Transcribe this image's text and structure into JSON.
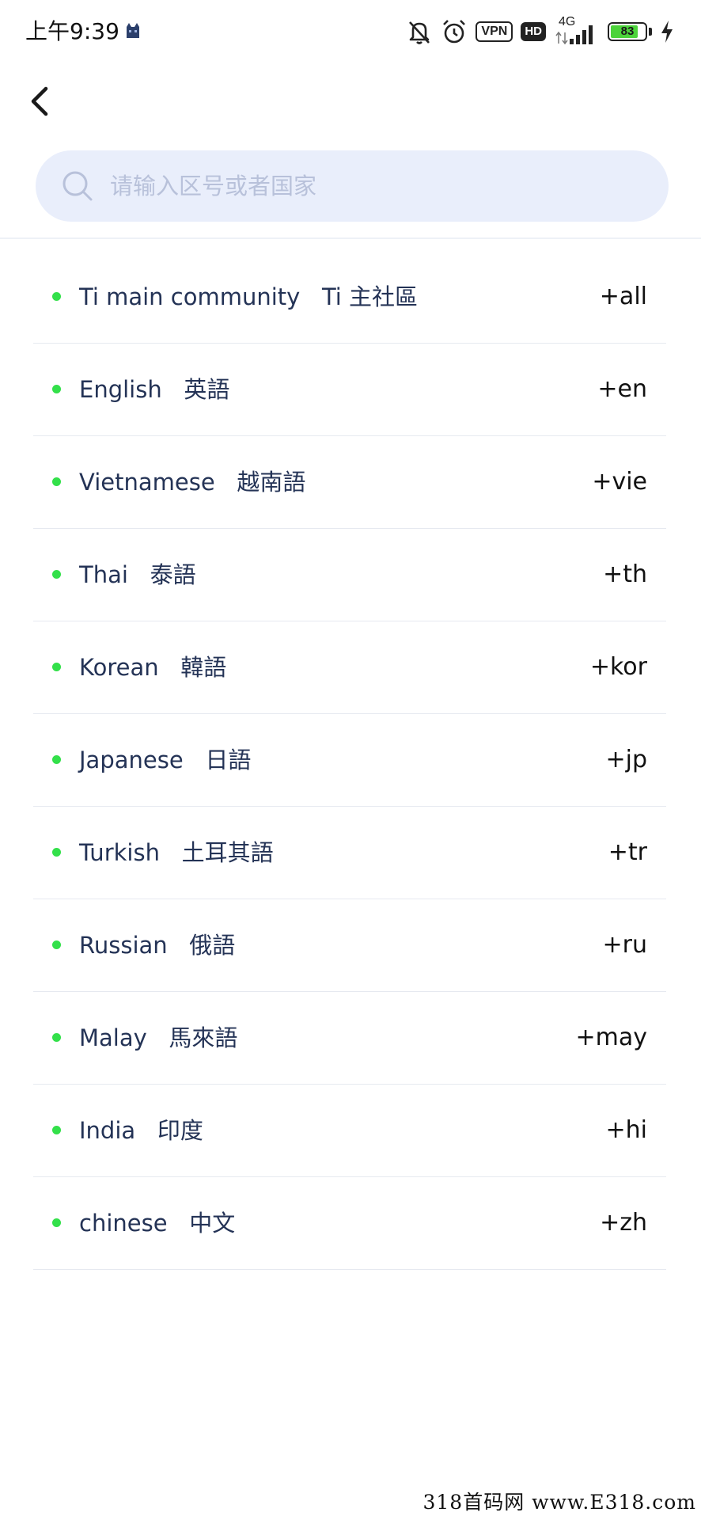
{
  "status_bar": {
    "time": "上午9:39",
    "vpn_label": "VPN",
    "hd_label": "HD",
    "network_label": "4G",
    "battery_level": "83",
    "battery_fraction": 0.83,
    "icons": [
      "cat-icon",
      "bell-muted-icon",
      "alarm-icon",
      "vpn-icon",
      "hd-icon",
      "signal-icon",
      "battery-icon",
      "charging-icon"
    ]
  },
  "header": {
    "back_icon": "chevron-left-icon"
  },
  "search": {
    "placeholder": "请输入区号或者国家",
    "value": "",
    "icon": "search-icon"
  },
  "languages": [
    {
      "name": "Ti main community   Ti 主社區",
      "code": "+all"
    },
    {
      "name": "English   英語",
      "code": "+en"
    },
    {
      "name": "Vietnamese   越南語",
      "code": "+vie"
    },
    {
      "name": "Thai   泰語",
      "code": "+th"
    },
    {
      "name": "Korean   韓語",
      "code": "+kor"
    },
    {
      "name": "Japanese   日語",
      "code": "+jp"
    },
    {
      "name": "Turkish   土耳其語",
      "code": "+tr"
    },
    {
      "name": "Russian   俄語",
      "code": "+ru"
    },
    {
      "name": "Malay   馬來語",
      "code": "+may"
    },
    {
      "name": "India   印度",
      "code": "+hi"
    },
    {
      "name": "chinese   中文",
      "code": "+zh"
    }
  ],
  "colors": {
    "dot": "#33e04a",
    "search_bg": "#e9eefb",
    "placeholder": "#b8c1da",
    "text": "#243356"
  },
  "watermark": "318首码网  www.E318.com"
}
